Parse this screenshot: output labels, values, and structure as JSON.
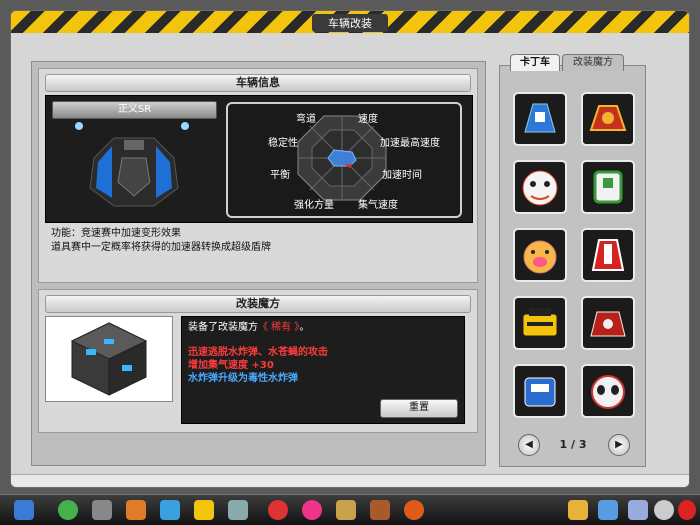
{
  "window": {
    "title": "车辆改装"
  },
  "vehicle_info": {
    "header": "车辆信息",
    "car_name": "正义SR",
    "radar_labels": [
      "弯道",
      "速度",
      "加速最高速度",
      "加速时间",
      "集气速度",
      "强化方量",
      "平衡",
      "稳定性"
    ],
    "description_lines": [
      "功能：竞速赛中加速变形效果",
      "道具赛中一定概率将获得的加速器转换成超级盾牌"
    ]
  },
  "mod_magic": {
    "header": "改装魔方",
    "equipped_prefix": "装备了改装魔方",
    "equipped_name": "《 稀有 》",
    "equipped_suffix": "。",
    "effect_lines": [
      {
        "text": "迅速逃脱水炸弹、水苍蝇的攻击",
        "color": "red"
      },
      {
        "text": "增加集气速度 +30",
        "color": "red"
      },
      {
        "text": "水炸弹升级为毒性水炸弹",
        "color": "blue"
      }
    ],
    "reset_label": "重置"
  },
  "sidebar": {
    "tabs": [
      {
        "label": "卡丁车",
        "active": true
      },
      {
        "label": "改装魔方",
        "active": false
      }
    ],
    "page_indicator": "1 / 3"
  },
  "colors": {
    "hazard_yellow": "#f2c40c",
    "effect_red": "#ff3b3b",
    "effect_blue": "#49a9ff"
  }
}
